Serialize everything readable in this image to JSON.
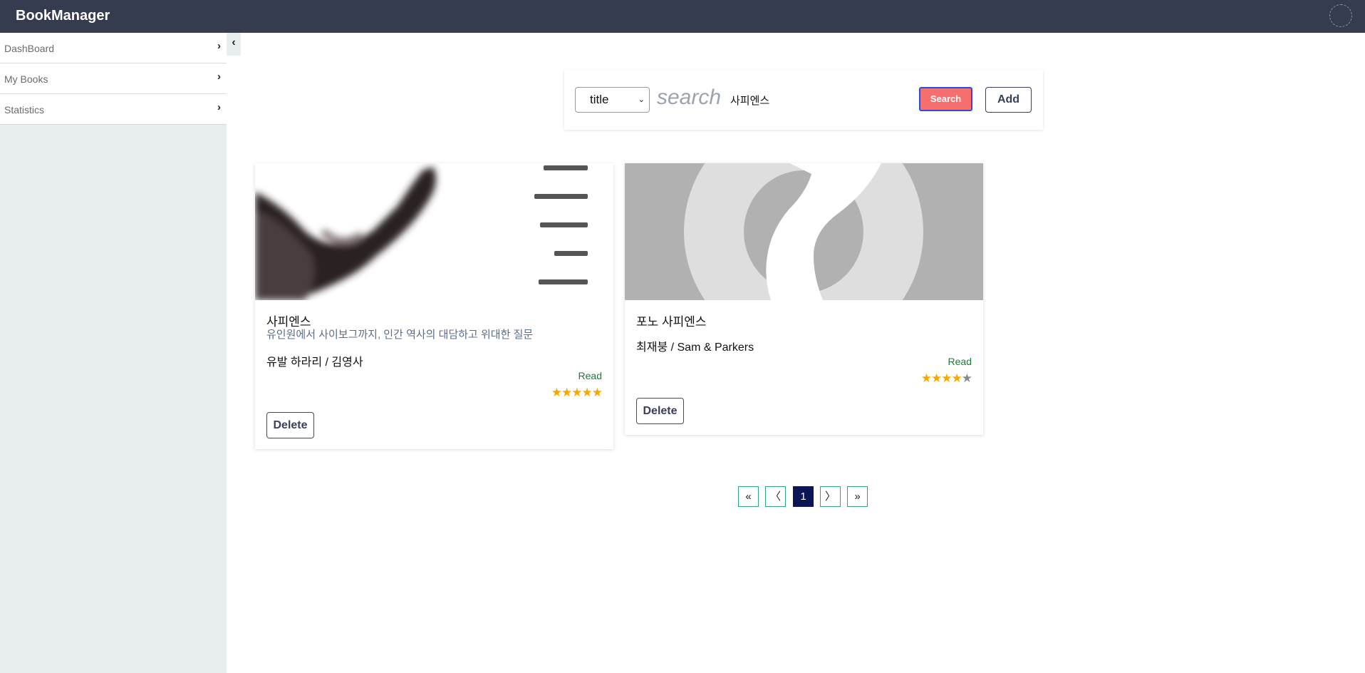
{
  "app": {
    "title": "BookManager"
  },
  "sidebar": {
    "items": [
      {
        "label": "DashBoard"
      },
      {
        "label": "My Books"
      },
      {
        "label": "Statistics"
      }
    ]
  },
  "search": {
    "field_selected": "title",
    "placeholder": "search",
    "value": "사피엔스",
    "search_label": "Search",
    "add_label": "Add"
  },
  "books": [
    {
      "title": "사피엔스",
      "subtitle": "유인원에서 사이보그까지, 인간 역사의 대담하고 위대한 질문",
      "authors": "유발 하라리 / 김영사",
      "status": "Read",
      "rating": 5,
      "max_rating": 5,
      "delete_label": "Delete"
    },
    {
      "title": "포노 사피엔스",
      "subtitle": "",
      "authors": "최재붕 / Sam & Parkers",
      "status": "Read",
      "rating": 4,
      "max_rating": 5,
      "delete_label": "Delete"
    }
  ],
  "pagination": {
    "first": "«",
    "prev": "〈",
    "current": "1",
    "next": "〉",
    "last": "»"
  },
  "colors": {
    "header_bg": "#363c4f",
    "search_button": "#f76e6e",
    "star": "#f5a800",
    "status_read": "#1e7a3a",
    "page_active": "#0c1654"
  }
}
